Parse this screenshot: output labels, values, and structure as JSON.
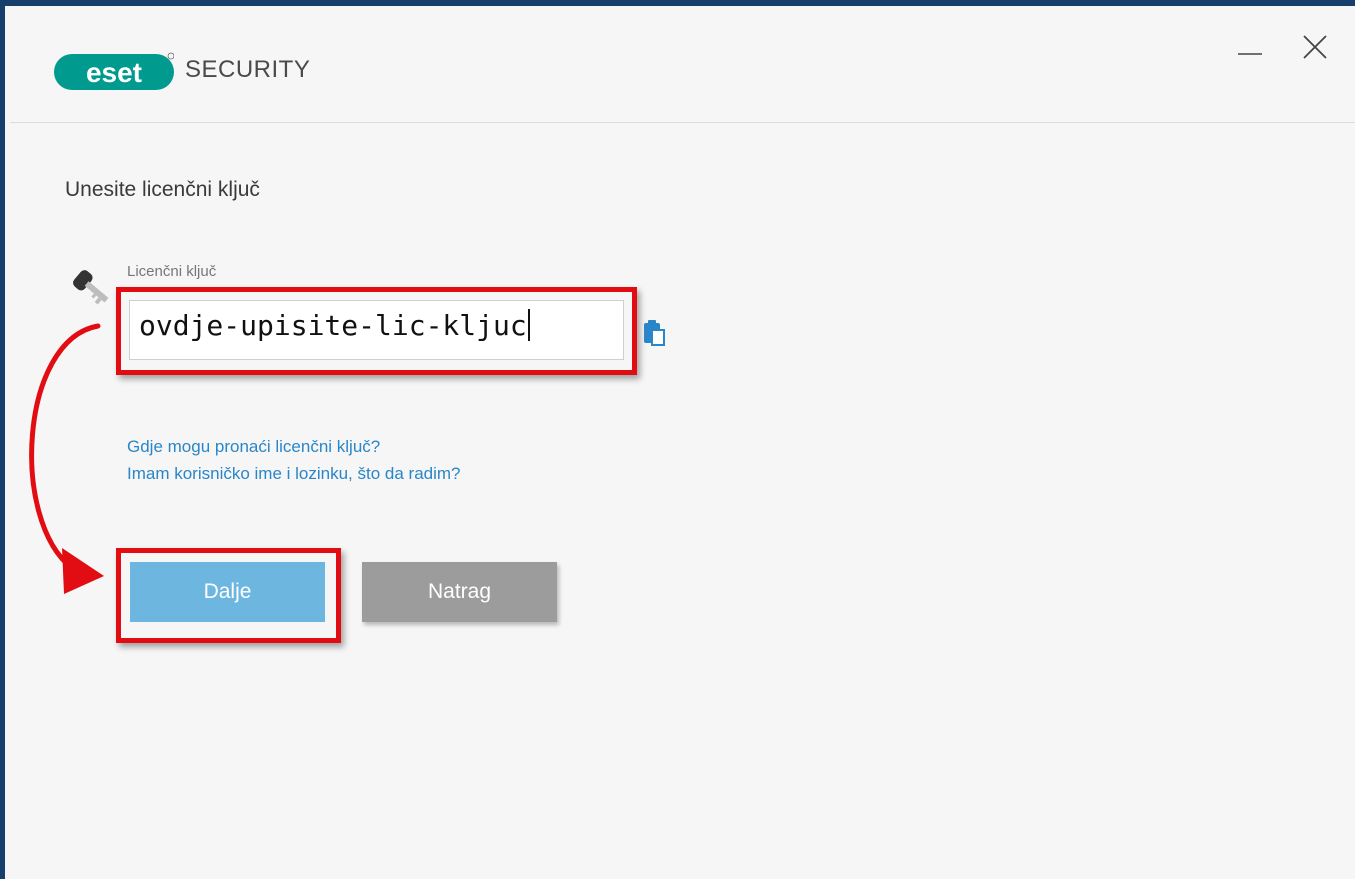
{
  "app": {
    "brand": "eset",
    "title": "SECURITY",
    "brand_color": "#009a8e",
    "window_controls": {
      "minimize_icon": "minimize-icon",
      "close_icon": "close-icon"
    }
  },
  "main": {
    "heading": "Unesite licenčni ključ",
    "license_field": {
      "label": "Licenčni ključ",
      "value": "ovdje-upisite-lic-kljuc",
      "icon": "key-icon",
      "paste_icon": "paste-icon"
    },
    "links": [
      "Gdje mogu pronaći licenčni ključ?",
      "Imam korisničko ime i lozinku, što da radim?"
    ],
    "buttons": {
      "next_label": "Dalje",
      "back_label": "Natrag"
    }
  },
  "colors": {
    "frame": "#173f6b",
    "highlight": "#e20d13",
    "link": "#2a86c8",
    "primary_button": "#6cb6df",
    "secondary_button": "#9c9c9c"
  }
}
